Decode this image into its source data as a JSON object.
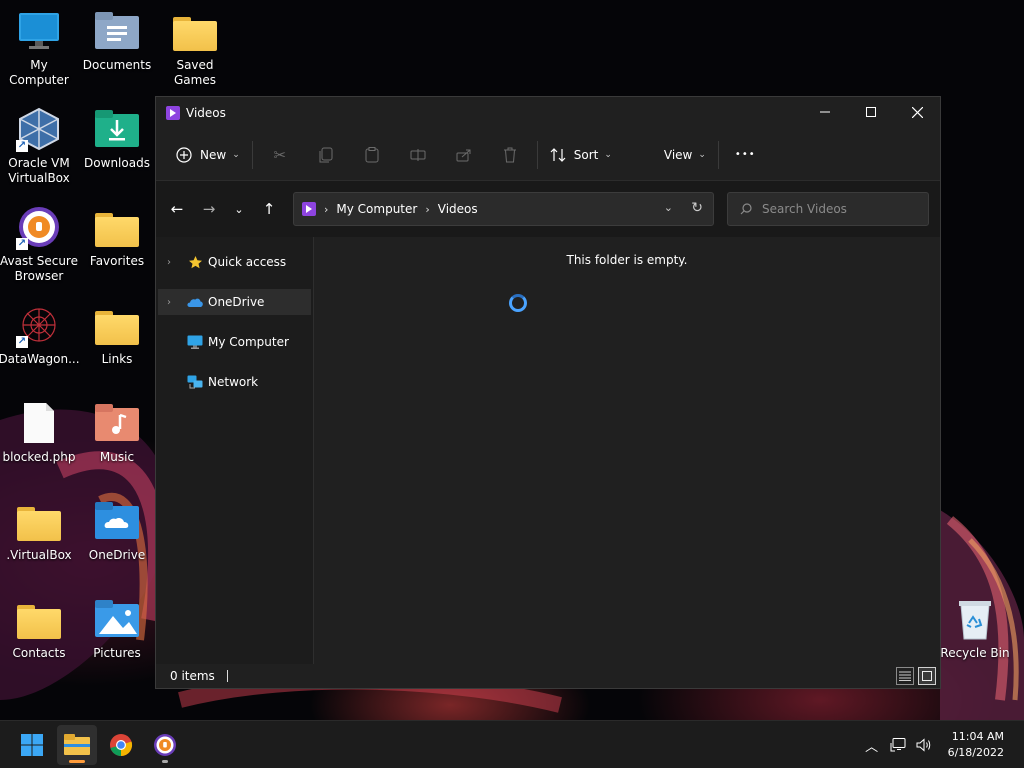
{
  "desktop": {
    "icons": [
      {
        "label": "My Computer",
        "icon": "monitor-icon"
      },
      {
        "label": "Documents",
        "icon": "documents-folder-icon"
      },
      {
        "label": "Saved Games",
        "icon": "folder-icon"
      },
      {
        "label": "Oracle VM VirtualBox",
        "icon": "virtualbox-icon"
      },
      {
        "label": "Downloads",
        "icon": "downloads-folder-icon"
      },
      {
        "label": "Avast Secure Browser",
        "icon": "avast-browser-icon"
      },
      {
        "label": "Favorites",
        "icon": "folder-icon"
      },
      {
        "label": "DataWagon...",
        "icon": "datawagon-icon"
      },
      {
        "label": "Links",
        "icon": "folder-icon"
      },
      {
        "label": "blocked.php",
        "icon": "file-icon"
      },
      {
        "label": "Music",
        "icon": "music-folder-icon"
      },
      {
        "label": ".VirtualBox",
        "icon": "folder-icon"
      },
      {
        "label": "OneDrive",
        "icon": "onedrive-folder-icon"
      },
      {
        "label": "Contacts",
        "icon": "folder-icon"
      },
      {
        "label": "Pictures",
        "icon": "pictures-folder-icon"
      },
      {
        "label": "Recycle Bin",
        "icon": "recycle-bin-icon"
      }
    ]
  },
  "window": {
    "title": "Videos",
    "toolbar": {
      "new_label": "New",
      "sort_label": "Sort",
      "view_label": "View",
      "more_label": "•••"
    },
    "address": {
      "crumbs": [
        "My Computer",
        "Videos"
      ]
    },
    "search": {
      "placeholder": "Search Videos"
    },
    "nav": {
      "items": [
        {
          "label": "Quick access",
          "icon": "star-icon"
        },
        {
          "label": "OneDrive",
          "icon": "cloud-icon"
        },
        {
          "label": "My Computer",
          "icon": "monitor-icon"
        },
        {
          "label": "Network",
          "icon": "network-icon"
        }
      ]
    },
    "content": {
      "empty_message": "This folder is empty."
    },
    "status": {
      "items_count": "0 items"
    }
  },
  "taskbar": {
    "clock_time": "11:04 AM",
    "clock_date": "6/18/2022"
  },
  "colors": {
    "accent": "#4aa3ff",
    "folder": "#f2c14a",
    "window_bg": "#202020"
  }
}
